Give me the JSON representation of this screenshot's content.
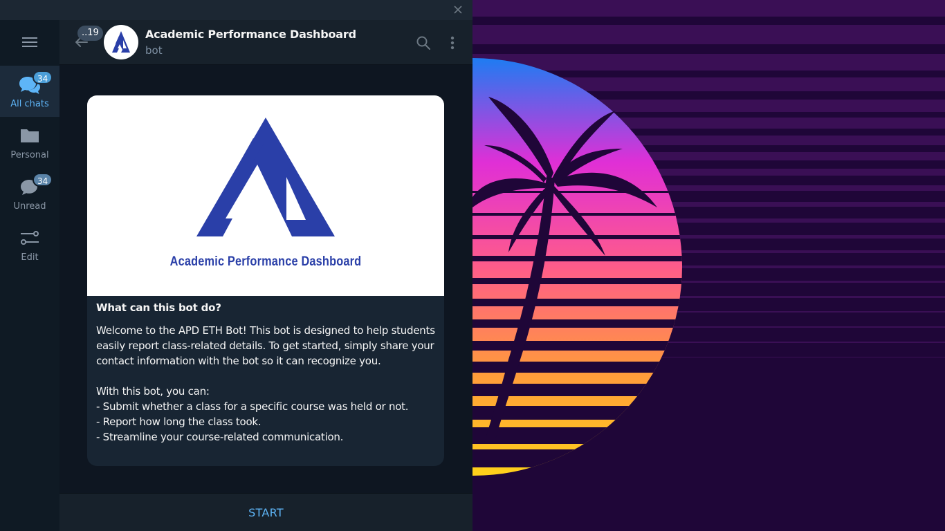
{
  "window": {
    "close_icon": "close-icon"
  },
  "folders": {
    "menu_icon": "hamburger-menu-icon",
    "items": [
      {
        "label": "All chats",
        "badge": "34",
        "icon": "chats-icon",
        "active": true
      },
      {
        "label": "Personal",
        "badge": "",
        "icon": "folder-icon",
        "active": false
      },
      {
        "label": "Unread",
        "badge": "34",
        "icon": "chat-bubble-icon",
        "active": false
      },
      {
        "label": "Edit",
        "badge": "",
        "icon": "sliders-icon",
        "active": false
      }
    ]
  },
  "header": {
    "back_badge": "..19",
    "title": "Academic Performance Dashboard",
    "subtitle": "bot",
    "search_icon": "search-icon",
    "more_icon": "more-vertical-icon"
  },
  "bot_card": {
    "logo_caption": "Academic Performance Dashboard",
    "heading": "What can this bot do?",
    "paragraph1": "Welcome to the APD ETH Bot! This bot is designed to help students easily report class-related details. To get started, simply share your contact information with the bot so it can recognize you.",
    "list_intro": "With this bot, you can:",
    "list": [
      "- Submit whether a class for a specific course was held or not.",
      "- Report how long the class took.",
      "- Streamline your course-related communication."
    ]
  },
  "start_bar": {
    "label": "START"
  },
  "colors": {
    "accent": "#5eb5f7",
    "logo_blue": "#2a3fa8",
    "window_bg": "#0e1621",
    "header_bg": "#17212b"
  }
}
